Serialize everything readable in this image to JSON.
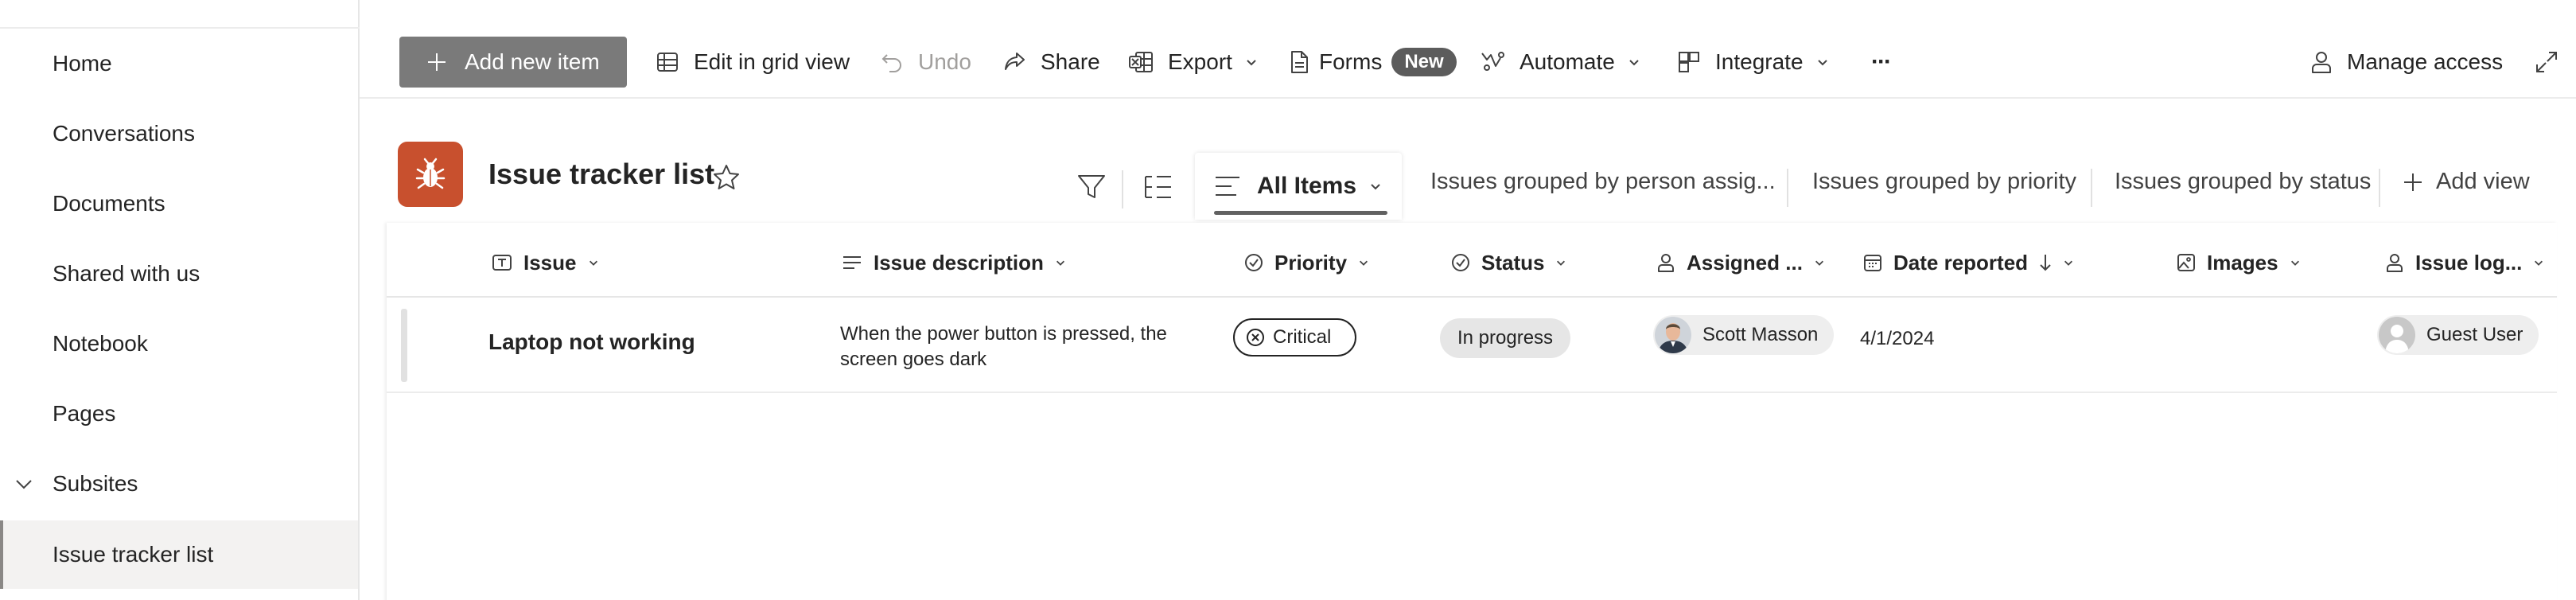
{
  "sidebar": {
    "items": [
      {
        "label": "Home"
      },
      {
        "label": "Conversations"
      },
      {
        "label": "Documents"
      },
      {
        "label": "Shared with us"
      },
      {
        "label": "Notebook"
      },
      {
        "label": "Pages"
      },
      {
        "label": "Subsites"
      },
      {
        "label": "Issue tracker list"
      }
    ]
  },
  "toolbar": {
    "add_new_item": "Add new item",
    "edit_grid": "Edit in grid view",
    "undo": "Undo",
    "share": "Share",
    "export": "Export",
    "forms": "Forms",
    "forms_badge": "New",
    "automate": "Automate",
    "integrate": "Integrate",
    "more": "···",
    "manage_access": "Manage access"
  },
  "list": {
    "title": "Issue tracker list",
    "icon_color": "#c8502e"
  },
  "views": {
    "active": "All Items",
    "tabs": [
      {
        "label": "Issues grouped by person assig..."
      },
      {
        "label": "Issues grouped by priority"
      },
      {
        "label": "Issues grouped by status"
      }
    ],
    "add_view": "Add view"
  },
  "table": {
    "columns": [
      {
        "label": "Issue"
      },
      {
        "label": "Issue description"
      },
      {
        "label": "Priority"
      },
      {
        "label": "Status"
      },
      {
        "label": "Assigned ..."
      },
      {
        "label": "Date reported"
      },
      {
        "label": "Images"
      },
      {
        "label": "Issue log..."
      }
    ],
    "rows": [
      {
        "issue": "Laptop not working",
        "description": "When the power button is pressed, the screen goes dark",
        "priority": "Critical",
        "status": "In progress",
        "assigned": "Scott Masson",
        "date_reported": "4/1/2024",
        "issue_logged_by": "Guest User"
      }
    ]
  }
}
